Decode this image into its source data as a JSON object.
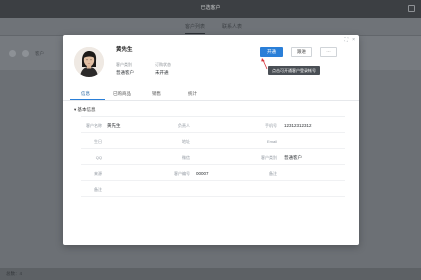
{
  "background": {
    "window_title": "已选客户",
    "tabs": [
      "客户列表",
      "联系人表"
    ],
    "toolbar_label": "客户",
    "footer_text": "总数：4"
  },
  "modal": {
    "controls": {
      "maximize": "⛶",
      "close": "×"
    },
    "customer": {
      "name": "黄先生",
      "fields": [
        {
          "label": "客户类别",
          "value": "普通客户"
        },
        {
          "label": "订购状态",
          "value": "未开通"
        }
      ]
    },
    "actions": {
      "primary": "开通",
      "secondary": "跟进",
      "more": "···"
    },
    "tooltip": "点击可开通客户登录帐号",
    "tabs": [
      "信息",
      "已购商品",
      "销售",
      "统计"
    ],
    "active_tab": 0,
    "section_title": "基本信息",
    "info_rows": [
      [
        {
          "label": "客户名称",
          "value": "黄先生"
        },
        {
          "label": "负责人",
          "value": ""
        },
        {
          "label": "手机号",
          "value": "12312312312"
        }
      ],
      [
        {
          "label": "生日",
          "value": ""
        },
        {
          "label": "地址",
          "value": ""
        },
        {
          "label": "Email",
          "value": ""
        }
      ],
      [
        {
          "label": "QQ",
          "value": ""
        },
        {
          "label": "微信",
          "value": ""
        },
        {
          "label": "客户类别",
          "value": "普通客户"
        }
      ],
      [
        {
          "label": "来源",
          "value": ""
        },
        {
          "label": "客户编号",
          "value": "00007"
        },
        {
          "label": "备注",
          "value": ""
        }
      ],
      [
        {
          "label": "备注",
          "value": ""
        }
      ]
    ]
  },
  "colors": {
    "primary": "#2a7fd8",
    "overlay": "#6b6f74",
    "tooltip": "#4a4f55"
  }
}
